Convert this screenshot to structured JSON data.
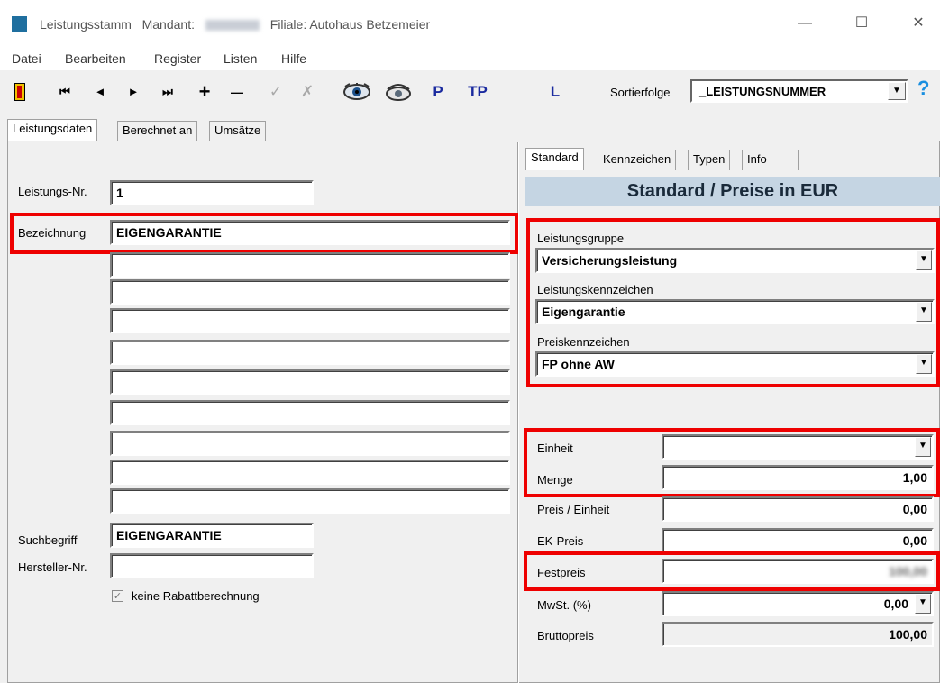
{
  "window": {
    "title_part1": "Leistungsstamm",
    "title_mandant_label": "Mandant:",
    "title_filiale": "Filiale: Autohaus Betzemeier",
    "minimize": "—",
    "maximize": "☐",
    "close": "✕"
  },
  "menu": [
    "Datei",
    "Bearbeiten",
    "Register",
    "Listen",
    "Hilfe"
  ],
  "toolbar": {
    "first": "⏮",
    "prev": "◄",
    "next": "►",
    "last": "⏭",
    "add": "+",
    "remove": "—",
    "confirm": "✓",
    "cancel": "✗",
    "p": "P",
    "tp": "TP",
    "l": "L",
    "sort_label": "Sortierfolge",
    "sort_value": "_LEISTUNGSNUMMER",
    "help": "?"
  },
  "main_tabs": [
    "Leistungsdaten",
    "Berechnet an",
    "Umsätze"
  ],
  "left": {
    "leistungs_nr_label": "Leistungs-Nr.",
    "leistungs_nr": "1",
    "bezeichnung_label": "Bezeichnung",
    "bezeichnung": "EIGENGARANTIE",
    "suchbegriff_label": "Suchbegriff",
    "suchbegriff": "EIGENGARANTIE",
    "hersteller_label": "Hersteller-Nr.",
    "hersteller": "",
    "rabatt_label": "keine Rabattberechnung",
    "rabatt_check": "✓"
  },
  "right_tabs": [
    "Standard",
    "Kennzeichen",
    "Typen",
    "Info"
  ],
  "right": {
    "header": "Standard / Preise in EUR",
    "leistungsgruppe_label": "Leistungsgruppe",
    "leistungsgruppe": "Versicherungsleistung",
    "leistungskennzeichen_label": "Leistungskennzeichen",
    "leistungskennzeichen": "Eigengarantie",
    "preiskennzeichen_label": "Preiskennzeichen",
    "preiskennzeichen": "FP ohne AW",
    "einheit_label": "Einheit",
    "einheit": "",
    "menge_label": "Menge",
    "menge": "1,00",
    "preis_einheit_label": "Preis / Einheit",
    "preis_einheit": "0,00",
    "ek_preis_label": "EK-Preis",
    "ek_preis": "0,00",
    "festpreis_label": "Festpreis",
    "festpreis": "100,00",
    "mwst_label": "MwSt. (%)",
    "mwst": "0,00",
    "bruttopreis_label": "Bruttopreis",
    "bruttopreis": "100,00",
    "dropdown_arrow": "▼"
  },
  "colors": {
    "highlight": "#e00000",
    "header_bg": "#c5d5e3",
    "help_blue": "#1a8fe0",
    "toolbar_blue": "#1a2a9f"
  }
}
